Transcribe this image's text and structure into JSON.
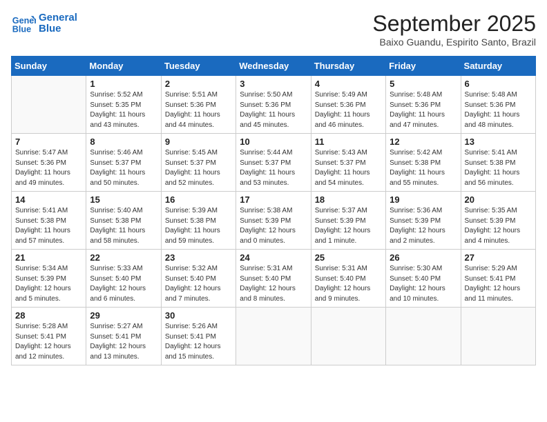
{
  "header": {
    "logo_line1": "General",
    "logo_line2": "Blue",
    "month": "September 2025",
    "location": "Baixo Guandu, Espirito Santo, Brazil"
  },
  "weekdays": [
    "Sunday",
    "Monday",
    "Tuesday",
    "Wednesday",
    "Thursday",
    "Friday",
    "Saturday"
  ],
  "weeks": [
    [
      {
        "day": "",
        "info": ""
      },
      {
        "day": "1",
        "info": "Sunrise: 5:52 AM\nSunset: 5:35 PM\nDaylight: 11 hours\nand 43 minutes."
      },
      {
        "day": "2",
        "info": "Sunrise: 5:51 AM\nSunset: 5:36 PM\nDaylight: 11 hours\nand 44 minutes."
      },
      {
        "day": "3",
        "info": "Sunrise: 5:50 AM\nSunset: 5:36 PM\nDaylight: 11 hours\nand 45 minutes."
      },
      {
        "day": "4",
        "info": "Sunrise: 5:49 AM\nSunset: 5:36 PM\nDaylight: 11 hours\nand 46 minutes."
      },
      {
        "day": "5",
        "info": "Sunrise: 5:48 AM\nSunset: 5:36 PM\nDaylight: 11 hours\nand 47 minutes."
      },
      {
        "day": "6",
        "info": "Sunrise: 5:48 AM\nSunset: 5:36 PM\nDaylight: 11 hours\nand 48 minutes."
      }
    ],
    [
      {
        "day": "7",
        "info": "Sunrise: 5:47 AM\nSunset: 5:36 PM\nDaylight: 11 hours\nand 49 minutes."
      },
      {
        "day": "8",
        "info": "Sunrise: 5:46 AM\nSunset: 5:37 PM\nDaylight: 11 hours\nand 50 minutes."
      },
      {
        "day": "9",
        "info": "Sunrise: 5:45 AM\nSunset: 5:37 PM\nDaylight: 11 hours\nand 52 minutes."
      },
      {
        "day": "10",
        "info": "Sunrise: 5:44 AM\nSunset: 5:37 PM\nDaylight: 11 hours\nand 53 minutes."
      },
      {
        "day": "11",
        "info": "Sunrise: 5:43 AM\nSunset: 5:37 PM\nDaylight: 11 hours\nand 54 minutes."
      },
      {
        "day": "12",
        "info": "Sunrise: 5:42 AM\nSunset: 5:38 PM\nDaylight: 11 hours\nand 55 minutes."
      },
      {
        "day": "13",
        "info": "Sunrise: 5:41 AM\nSunset: 5:38 PM\nDaylight: 11 hours\nand 56 minutes."
      }
    ],
    [
      {
        "day": "14",
        "info": "Sunrise: 5:41 AM\nSunset: 5:38 PM\nDaylight: 11 hours\nand 57 minutes."
      },
      {
        "day": "15",
        "info": "Sunrise: 5:40 AM\nSunset: 5:38 PM\nDaylight: 11 hours\nand 58 minutes."
      },
      {
        "day": "16",
        "info": "Sunrise: 5:39 AM\nSunset: 5:38 PM\nDaylight: 11 hours\nand 59 minutes."
      },
      {
        "day": "17",
        "info": "Sunrise: 5:38 AM\nSunset: 5:39 PM\nDaylight: 12 hours\nand 0 minutes."
      },
      {
        "day": "18",
        "info": "Sunrise: 5:37 AM\nSunset: 5:39 PM\nDaylight: 12 hours\nand 1 minute."
      },
      {
        "day": "19",
        "info": "Sunrise: 5:36 AM\nSunset: 5:39 PM\nDaylight: 12 hours\nand 2 minutes."
      },
      {
        "day": "20",
        "info": "Sunrise: 5:35 AM\nSunset: 5:39 PM\nDaylight: 12 hours\nand 4 minutes."
      }
    ],
    [
      {
        "day": "21",
        "info": "Sunrise: 5:34 AM\nSunset: 5:39 PM\nDaylight: 12 hours\nand 5 minutes."
      },
      {
        "day": "22",
        "info": "Sunrise: 5:33 AM\nSunset: 5:40 PM\nDaylight: 12 hours\nand 6 minutes."
      },
      {
        "day": "23",
        "info": "Sunrise: 5:32 AM\nSunset: 5:40 PM\nDaylight: 12 hours\nand 7 minutes."
      },
      {
        "day": "24",
        "info": "Sunrise: 5:31 AM\nSunset: 5:40 PM\nDaylight: 12 hours\nand 8 minutes."
      },
      {
        "day": "25",
        "info": "Sunrise: 5:31 AM\nSunset: 5:40 PM\nDaylight: 12 hours\nand 9 minutes."
      },
      {
        "day": "26",
        "info": "Sunrise: 5:30 AM\nSunset: 5:40 PM\nDaylight: 12 hours\nand 10 minutes."
      },
      {
        "day": "27",
        "info": "Sunrise: 5:29 AM\nSunset: 5:41 PM\nDaylight: 12 hours\nand 11 minutes."
      }
    ],
    [
      {
        "day": "28",
        "info": "Sunrise: 5:28 AM\nSunset: 5:41 PM\nDaylight: 12 hours\nand 12 minutes."
      },
      {
        "day": "29",
        "info": "Sunrise: 5:27 AM\nSunset: 5:41 PM\nDaylight: 12 hours\nand 13 minutes."
      },
      {
        "day": "30",
        "info": "Sunrise: 5:26 AM\nSunset: 5:41 PM\nDaylight: 12 hours\nand 15 minutes."
      },
      {
        "day": "",
        "info": ""
      },
      {
        "day": "",
        "info": ""
      },
      {
        "day": "",
        "info": ""
      },
      {
        "day": "",
        "info": ""
      }
    ]
  ]
}
